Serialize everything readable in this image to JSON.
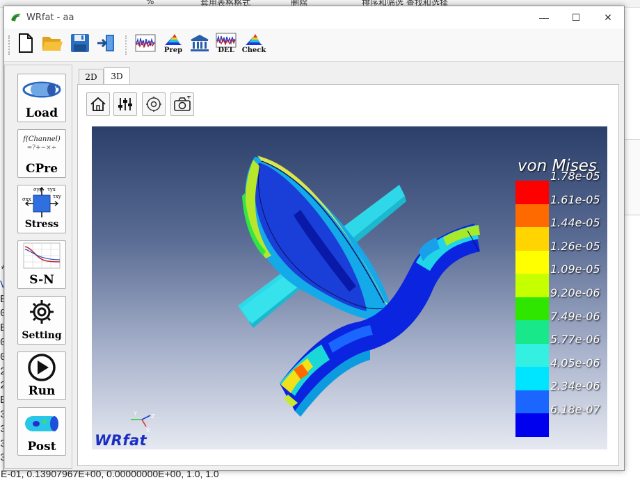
{
  "background": {
    "ribbon_items": [
      "%",
      "套用表格格式",
      "删除",
      "排序和筛选  查找和选择"
    ],
    "left_column": [
      "*",
      "V",
      "E",
      "0",
      "E",
      "0",
      "0",
      "2",
      "2",
      "B",
      "3",
      "3",
      "3",
      "3"
    ],
    "bottom_line": "E-01,  0.13907967E+00,  0.00000000E+00,  1.0,  1.0"
  },
  "window": {
    "title": "WRfat - aa",
    "minimize_glyph": "—",
    "maximize_glyph": "☐",
    "close_glyph": "✕"
  },
  "toolbar": {
    "prep_label": "Prep",
    "del_label": "DEL",
    "check_label": "Check"
  },
  "sidebar": {
    "load_label": "Load",
    "cpre_label": "CPre",
    "cpre_formula": "f(Channel)",
    "cpre_ops": "=?+−×÷",
    "stress_label": "Stress",
    "sn_label": "S-N",
    "setting_label": "Setting",
    "run_label": "Run",
    "post_label": "Post"
  },
  "tabs": {
    "tab_2d": "2D",
    "tab_3d": "3D"
  },
  "viewport": {
    "legend_title": "von Mises",
    "legend_values": [
      "1.78e-05",
      "1.61e-05",
      "1.44e-05",
      "1.26e-05",
      "1.09e-05",
      "9.20e-06",
      "7.49e-06",
      "5.77e-06",
      "4.05e-06",
      "2.34e-06",
      "6.18e-07"
    ],
    "legend_colors": [
      "#ff0000",
      "#ff6a00",
      "#ffd400",
      "#ffff00",
      "#c6ff00",
      "#2ee600",
      "#19e88a",
      "#33f0e0",
      "#00e5ff",
      "#1a66ff",
      "#0000ee"
    ],
    "brand": "WRfat",
    "axis_labels": {
      "y": "Y",
      "z": "Z",
      "x": "X"
    }
  }
}
